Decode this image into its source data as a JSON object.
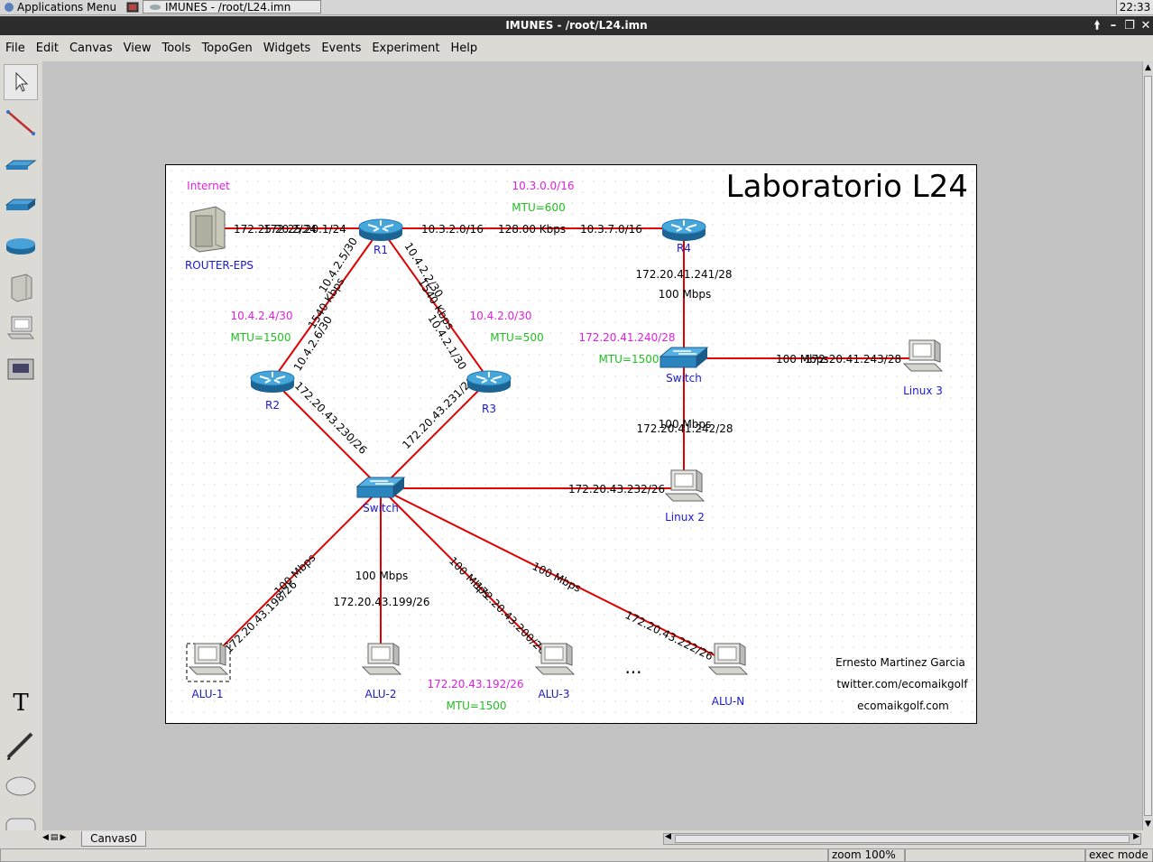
{
  "taskbar": {
    "apps_menu": "Applications Menu",
    "task_title": "IMUNES - /root/L24.imn",
    "clock": "22:33"
  },
  "window": {
    "title": "IMUNES - /root/L24.imn"
  },
  "menubar": [
    "File",
    "Edit",
    "Canvas",
    "View",
    "Tools",
    "TopoGen",
    "Widgets",
    "Events",
    "Experiment",
    "Help"
  ],
  "tools": [
    "select-icon",
    "link-icon",
    "hub-icon",
    "lanswitch-icon",
    "router-icon",
    "host-icon",
    "pc-icon",
    "rj45-icon",
    "text-icon",
    "freeform-icon",
    "oval-icon",
    "rectangle-icon"
  ],
  "canvas": {
    "tab": "Canvas0",
    "heading": "Laboratorio L24",
    "credits": [
      "Ernesto Martinez Garcia",
      "twitter.com/ecomaikgolf",
      "ecomaikgolf.com"
    ],
    "annotations": [
      {
        "text": "Internet",
        "color": "#e020e0"
      },
      {
        "text": "10.3.0.0/16",
        "color": "#e020e0"
      },
      {
        "text": "MTU=600",
        "color": "#20c020"
      },
      {
        "text": "10.4.2.4/30",
        "color": "#e020e0"
      },
      {
        "text": "MTU=1500",
        "color": "#20c020"
      },
      {
        "text": "10.4.2.0/30",
        "color": "#e020e0"
      },
      {
        "text": "MTU=500",
        "color": "#20c020"
      },
      {
        "text": "172.20.41.240/28",
        "color": "#e020e0"
      },
      {
        "text": "MTU=1500",
        "color": "#20c020"
      },
      {
        "text": "172.20.43.192/26",
        "color": "#e020e0"
      },
      {
        "text": "MTU=1500",
        "color": "#20c020"
      },
      {
        "text": "...",
        "color": "#000000"
      }
    ],
    "nodes": [
      {
        "name": "ROUTER-EPS",
        "type": "host"
      },
      {
        "name": "R1",
        "type": "router"
      },
      {
        "name": "R4",
        "type": "router"
      },
      {
        "name": "R2",
        "type": "router"
      },
      {
        "name": "R3",
        "type": "router"
      },
      {
        "name": "Switch",
        "type": "switch"
      },
      {
        "name": "Switch",
        "type": "switch"
      },
      {
        "name": "Linux 3",
        "type": "pc"
      },
      {
        "name": "Linux 2",
        "type": "pc"
      },
      {
        "name": "ALU-1",
        "type": "pc"
      },
      {
        "name": "ALU-2",
        "type": "pc"
      },
      {
        "name": "ALU-3",
        "type": "pc"
      },
      {
        "name": "ALU-N",
        "type": "pc"
      }
    ],
    "link_labels": [
      "172.25.20.2/24",
      "172.25.20.1/24",
      "10.3.2.0/16",
      "128.00 Kbps",
      "10.3.7.0/16",
      "10.4.2.5/30",
      "1540 Kbps",
      "10.4.2.6/30",
      "10.4.2.2/30",
      "1540 Kbps",
      "10.4.2.1/30",
      "172.20.41.241/28",
      "100 Mbps",
      "100 Mbps",
      "172.20.41.243/28",
      "100 Mbps",
      "172.20.41.242/28",
      "172.20.43.230/26",
      "172.20.43.231/26",
      "172.20.43.232/26",
      "100 Mbps",
      "172.20.43.198/26",
      "100 Mbps",
      "172.20.43.199/26",
      "100 Mbps",
      "172.20.43.200/26",
      "100 Mbps",
      "172.20.43.222/26"
    ]
  },
  "status": {
    "zoom": "zoom 100%",
    "mode": "exec mode"
  }
}
